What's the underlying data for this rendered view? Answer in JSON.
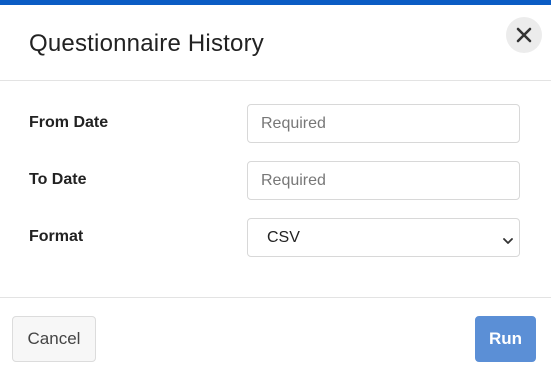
{
  "dialog": {
    "title": "Questionnaire History",
    "close_icon": "close-icon",
    "accent_color": "#0b5cc4"
  },
  "form": {
    "from_date": {
      "label": "From Date",
      "value": "",
      "placeholder": "Required"
    },
    "to_date": {
      "label": "To Date",
      "value": "",
      "placeholder": "Required"
    },
    "format": {
      "label": "Format",
      "selected": "CSV",
      "chevron_icon": "chevron-down-icon"
    }
  },
  "footer": {
    "cancel_label": "Cancel",
    "run_label": "Run",
    "run_color": "#5b8fd6"
  }
}
